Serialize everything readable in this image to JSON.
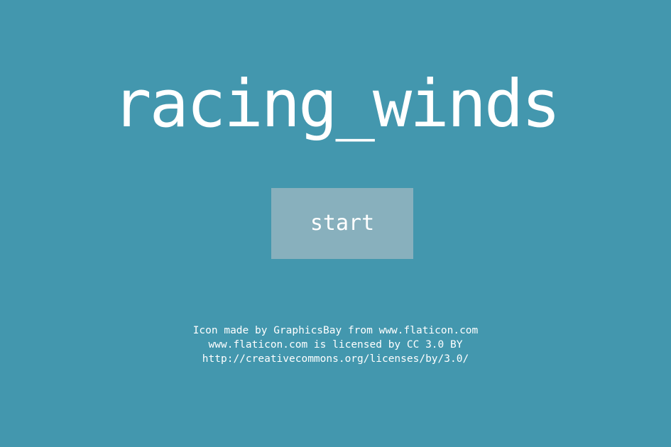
{
  "game": {
    "title": "racing_winds",
    "start_label": "start"
  },
  "credits": {
    "lines": [
      "Icon made by GraphicsBay from www.flaticon.com",
      "www.flaticon.com is licensed by CC 3.0 BY",
      "http://creativecommons.org/licenses/by/3.0/"
    ]
  },
  "colors": {
    "background": "#4397ae",
    "button": "#88b0bd",
    "text": "#ffffff"
  }
}
